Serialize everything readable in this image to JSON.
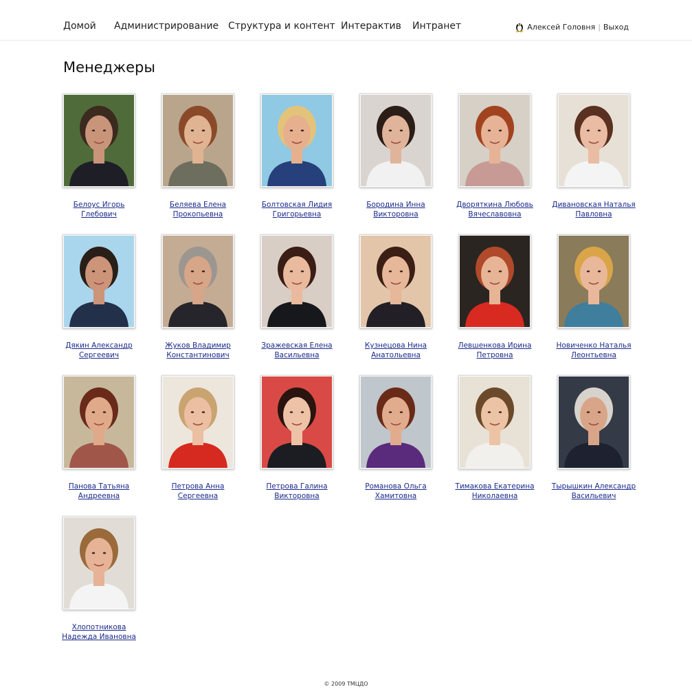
{
  "nav": {
    "items": [
      "Домой",
      "Администрирование",
      "Структура и контент",
      "Интерактив",
      "Интранет"
    ]
  },
  "user": {
    "name": "Алексей Головня",
    "logout": "Выход"
  },
  "page": {
    "title": "Менеджеры"
  },
  "people": [
    {
      "name": "Белоус Игорь Глебович",
      "bg": "#4f6b3a",
      "hair": "#3b2a1e",
      "skin": "#c9957a",
      "cloth": "#1e1f26"
    },
    {
      "name": "Беляева Елена Прокопьевна",
      "bg": "#b9a58c",
      "hair": "#8a4a2a",
      "skin": "#e0b392",
      "cloth": "#6e6e5e"
    },
    {
      "name": "Болтовская Лидия Григорьевна",
      "bg": "#8fc9e3",
      "hair": "#e3c37a",
      "skin": "#e6b08f",
      "cloth": "#25407a"
    },
    {
      "name": "Бородина Инна Викторовна",
      "bg": "#d9d4cf",
      "hair": "#2b1d17",
      "skin": "#e0b49a",
      "cloth": "#f1f1f1"
    },
    {
      "name": "Дворяткина Любовь Вячеславовна",
      "bg": "#d6d0c6",
      "hair": "#a2431f",
      "skin": "#e6b396",
      "cloth": "#c79a95"
    },
    {
      "name": "Дивановская Наталья Павловна",
      "bg": "#e7e0d6",
      "hair": "#5a3020",
      "skin": "#e9bca3",
      "cloth": "#f4f4f4"
    },
    {
      "name": "Дякин Александр Сергеевич",
      "bg": "#a9d6ec",
      "hair": "#2a1e18",
      "skin": "#cc9478",
      "cloth": "#22304a"
    },
    {
      "name": "Жуков Владимир Константинович",
      "bg": "#c4ab93",
      "hair": "#9c9690",
      "skin": "#d7a587",
      "cloth": "#26252b"
    },
    {
      "name": "Зражевская Елена Васильевна",
      "bg": "#d8cec6",
      "hair": "#3a1d15",
      "skin": "#e9ba9d",
      "cloth": "#17181c"
    },
    {
      "name": "Кузнецова Нина Анатольевна",
      "bg": "#e3c6a9",
      "hair": "#3b1f15",
      "skin": "#e7b79a",
      "cloth": "#222026"
    },
    {
      "name": "Левшенкова Ирина Петровна",
      "bg": "#2a2521",
      "hair": "#b04a2a",
      "skin": "#e7b496",
      "cloth": "#d92a22"
    },
    {
      "name": "Новиченко Наталья Леонтьевна",
      "bg": "#8a7b5a",
      "hair": "#d9a548",
      "skin": "#e9b89a",
      "cloth": "#3f7e9c"
    },
    {
      "name": "Панова Татьяна Андреевна",
      "bg": "#c7b89c",
      "hair": "#6a2a1a",
      "skin": "#dfa98a",
      "cloth": "#a0574a"
    },
    {
      "name": "Петрова Анна Сергеевна",
      "bg": "#ece6dc",
      "hair": "#c9a470",
      "skin": "#ecbea2",
      "cloth": "#d62a20"
    },
    {
      "name": "Петрова Галина Викторовна",
      "bg": "#d94a46",
      "hair": "#2a140f",
      "skin": "#edc2a6",
      "cloth": "#1c1d22"
    },
    {
      "name": "Романова Ольга Хамитовна",
      "bg": "#bfc6cc",
      "hair": "#6a2a18",
      "skin": "#e1ac8e",
      "cloth": "#5a2a7c"
    },
    {
      "name": "Тимакова Екатерина Николаевна",
      "bg": "#e8e1d6",
      "hair": "#6a4a2a",
      "skin": "#edc3a6",
      "cloth": "#f2f0ec"
    },
    {
      "name": "Тырышкин Александр Васильевич",
      "bg": "#343b47",
      "hair": "#d7d3cc",
      "skin": "#d9a588",
      "cloth": "#1e2230"
    },
    {
      "name": "Хлопотникова Надежда Ивановна",
      "bg": "#e1ddd6",
      "hair": "#9a6a3a",
      "skin": "#e6b396",
      "cloth": "#f4f4f4"
    }
  ],
  "footer": {
    "copyright": "© 2009 ТМЦДО"
  }
}
